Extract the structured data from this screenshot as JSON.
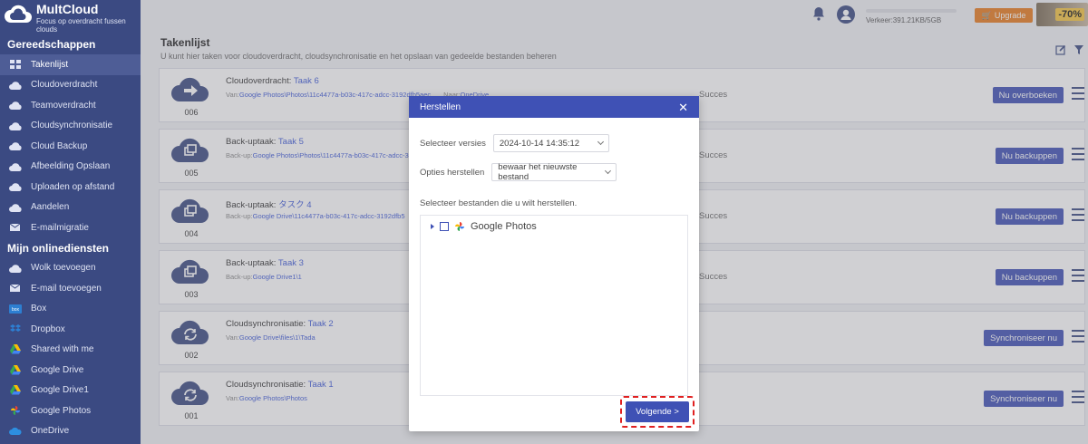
{
  "brand": {
    "name": "MultCloud",
    "tagline": "Focus op overdracht fussen clouds"
  },
  "sidebar": {
    "tools_title": "Gereedschappen",
    "tools": [
      {
        "label": "Takenlijst",
        "icon": "grid-icon",
        "active": true
      },
      {
        "label": "Cloudoverdracht",
        "icon": "cloud-transfer-icon"
      },
      {
        "label": "Teamoverdracht",
        "icon": "team-transfer-icon"
      },
      {
        "label": "Cloudsynchronisatie",
        "icon": "cloud-sync-icon"
      },
      {
        "label": "Cloud Backup",
        "icon": "cloud-backup-icon"
      },
      {
        "label": "Afbeelding Opslaan",
        "icon": "image-save-icon"
      },
      {
        "label": "Uploaden op afstand",
        "icon": "remote-upload-icon"
      },
      {
        "label": "Aandelen",
        "icon": "share-icon"
      },
      {
        "label": "E-mailmigratie",
        "icon": "email-migration-icon"
      }
    ],
    "services_title": "Mijn onlinediensten",
    "services": [
      {
        "label": "Wolk toevoegen",
        "icon": "add-cloud-icon"
      },
      {
        "label": "E-mail toevoegen",
        "icon": "add-email-icon"
      },
      {
        "label": "Box",
        "icon": "box-icon"
      },
      {
        "label": "Dropbox",
        "icon": "dropbox-icon"
      },
      {
        "label": "Shared with me",
        "icon": "shared-drive-icon"
      },
      {
        "label": "Google Drive",
        "icon": "google-drive-icon"
      },
      {
        "label": "Google Drive1",
        "icon": "google-drive-icon"
      },
      {
        "label": "Google Photos",
        "icon": "google-photos-icon"
      },
      {
        "label": "OneDrive",
        "icon": "onedrive-icon"
      }
    ]
  },
  "topbar": {
    "traffic": "Verkeer:391.21KB/5GB",
    "upgrade": "Upgrade",
    "promo": "-70%"
  },
  "main": {
    "title": "Takenlijst",
    "description": "U kunt hier taken voor cloudoverdracht, cloudsynchronisatie en het opslaan van gedeelde bestanden beheren"
  },
  "tasks": [
    {
      "type": "Cloudoverdracht:",
      "name": "Taak 6",
      "path_label": "Van:",
      "path": "Google Photos\\Photos\\11c4477a-b03c-417c-adcc-3192dfb5aec",
      "to_label": "Naar:",
      "to": "OneDrive",
      "num": "006",
      "status": "Succes",
      "button": "Nu overboeken",
      "icon": "transfer-icon"
    },
    {
      "type": "Back-uptaak:",
      "name": "Taak 5",
      "path_label": "Back-up:",
      "path": "Google Photos\\Photos\\11c4477a-b03c-417c-adcc-3192dfb5aec",
      "num": "005",
      "status": "Succes",
      "button": "Nu backuppen",
      "icon": "backup-icon"
    },
    {
      "type": "Back-uptaak:",
      "name": "タスク 4",
      "path_label": "Back-up:",
      "path": "Google Drive\\11c4477a-b03c-417c-adcc-3192dfb5",
      "num": "004",
      "status": "Succes",
      "button": "Nu backuppen",
      "icon": "backup-icon"
    },
    {
      "type": "Back-uptaak:",
      "name": "Taak 3",
      "path_label": "Back-up:",
      "path": "Google Drive1\\1",
      "num": "003",
      "status": "Succes",
      "button": "Nu backuppen",
      "icon": "backup-icon"
    },
    {
      "type": "Cloudsynchronisatie:",
      "name": "Taak 2",
      "path_label": "Van:",
      "path": "Google Drive\\files\\1\\Tada",
      "num": "002",
      "status": "",
      "button": "Synchroniseer nu",
      "icon": "sync-icon"
    },
    {
      "type": "Cloudsynchronisatie:",
      "name": "Taak 1",
      "path_label": "Van:",
      "path": "Google Photos\\Photos",
      "num": "001",
      "status": "",
      "button": "Synchroniseer nu",
      "icon": "sync-icon"
    }
  ],
  "modal": {
    "title": "Herstellen",
    "version_label": "Selecteer versies",
    "version_value": "2024-10-14 14:35:12",
    "options_label": "Opties herstellen",
    "options_value": "bewaar het nieuwste bestand",
    "hint": "Selecteer bestanden die u wilt herstellen.",
    "tree_item": "Google Photos",
    "next_button": "Volgende >"
  },
  "colors": {
    "sidebar": "#3b4a82",
    "accent": "#3f51b5",
    "link": "#3f5bd8",
    "upgrade": "#e87c1e",
    "highlight": "#e02020"
  }
}
